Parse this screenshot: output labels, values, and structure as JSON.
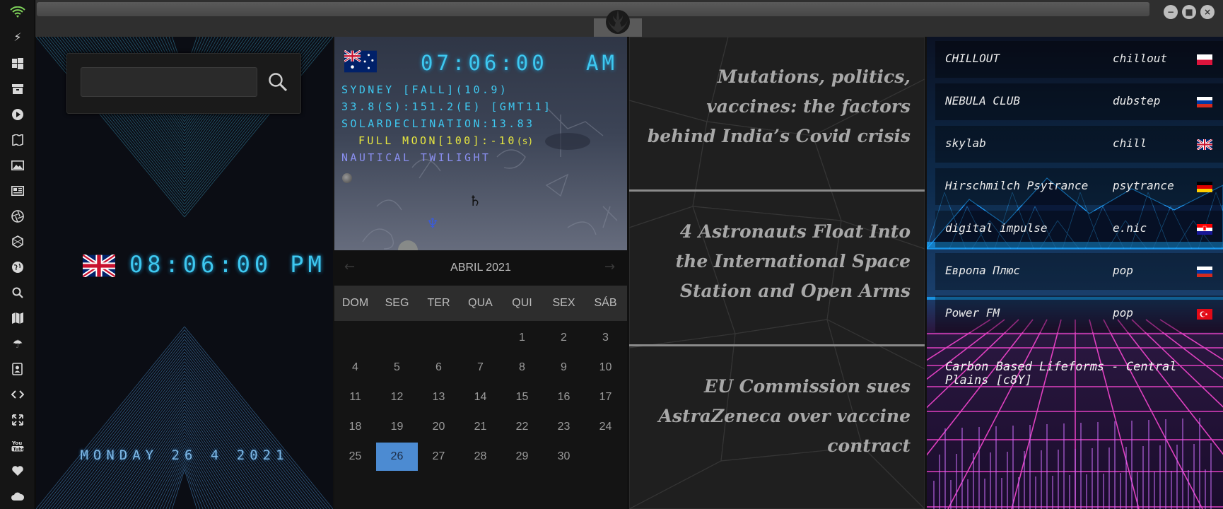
{
  "sidebar": {
    "icons": [
      "wifi-icon",
      "lightning-icon",
      "windows-icon",
      "archive-icon",
      "play-icon",
      "map-book-icon",
      "image-icon",
      "news-icon",
      "aperture-icon",
      "hexagon-icon",
      "globe-icon",
      "search-icon",
      "map-icon",
      "umbrella-icon",
      "contacts-icon",
      "code-icon",
      "fullscreen-icon",
      "youtube-icon",
      "heart-icon",
      "cloud-icon"
    ]
  },
  "clock": {
    "search_placeholder": "",
    "time": "08:06:00 PM",
    "date": "MONDAY 26 4 2021",
    "accent": "#3ec8f0"
  },
  "sky": {
    "time": "07:06:00",
    "ampm": "AM",
    "location": "SYDNEY [FALL](10.9)",
    "coords": "33.8(S):151.2(E) [GMT11]",
    "declination": "SOLARDECLINATION:13.83",
    "moon": "FULL MOON[100]:-10",
    "moon_suffix": "(s)",
    "twilight": "NAUTICAL TWILIGHT",
    "saturn": "♄",
    "neptune": "♆"
  },
  "calendar": {
    "title": "ABRIL 2021",
    "prev": "←",
    "next": "→",
    "weekdays": [
      "DOM",
      "SEG",
      "TER",
      "QUA",
      "QUI",
      "SEX",
      "SÁB"
    ],
    "days": [
      [
        "",
        "",
        "",
        "",
        "1",
        "2",
        "3"
      ],
      [
        "4",
        "5",
        "6",
        "7",
        "8",
        "9",
        "10"
      ],
      [
        "11",
        "12",
        "13",
        "14",
        "15",
        "16",
        "17"
      ],
      [
        "18",
        "19",
        "20",
        "21",
        "22",
        "23",
        "24"
      ],
      [
        "25",
        "26",
        "27",
        "28",
        "29",
        "30",
        ""
      ]
    ],
    "selected": "26",
    "selected_color": "#4c8bd2"
  },
  "news": [
    {
      "title": "Mutations, politics, vaccines: the factors behind India’s Covid crisis"
    },
    {
      "title": "4 Astronauts Float Into the International Space Station and Open Arms"
    },
    {
      "title": "EU Commission sues AstraZeneca over vaccine contract"
    }
  ],
  "radio": {
    "stations": [
      {
        "name": "CHILLOUT",
        "genre": "chillout",
        "flag": "poland-flag"
      },
      {
        "name": "NEBULA CLUB",
        "genre": "dubstep",
        "flag": "russia-flag"
      },
      {
        "name": "skylab",
        "genre": "chill",
        "flag": "uk-flag"
      },
      {
        "name": "Hirschmilch Psytrance",
        "genre": "psytrance",
        "flag": "germany-flag"
      },
      {
        "name": "digital impulse",
        "genre": "e.nic",
        "flag": "croatia-flag"
      },
      {
        "name": "Европа Плюс",
        "genre": "pop",
        "flag": "russia-flag"
      },
      {
        "name": "Power FM",
        "genre": "pop",
        "flag": "turkey-flag"
      }
    ],
    "now_playing": "Carbon Based Lifeforms - Central Plains [c8Y]"
  },
  "window": {
    "minimize": "−",
    "maximize": "■",
    "close": "×"
  }
}
